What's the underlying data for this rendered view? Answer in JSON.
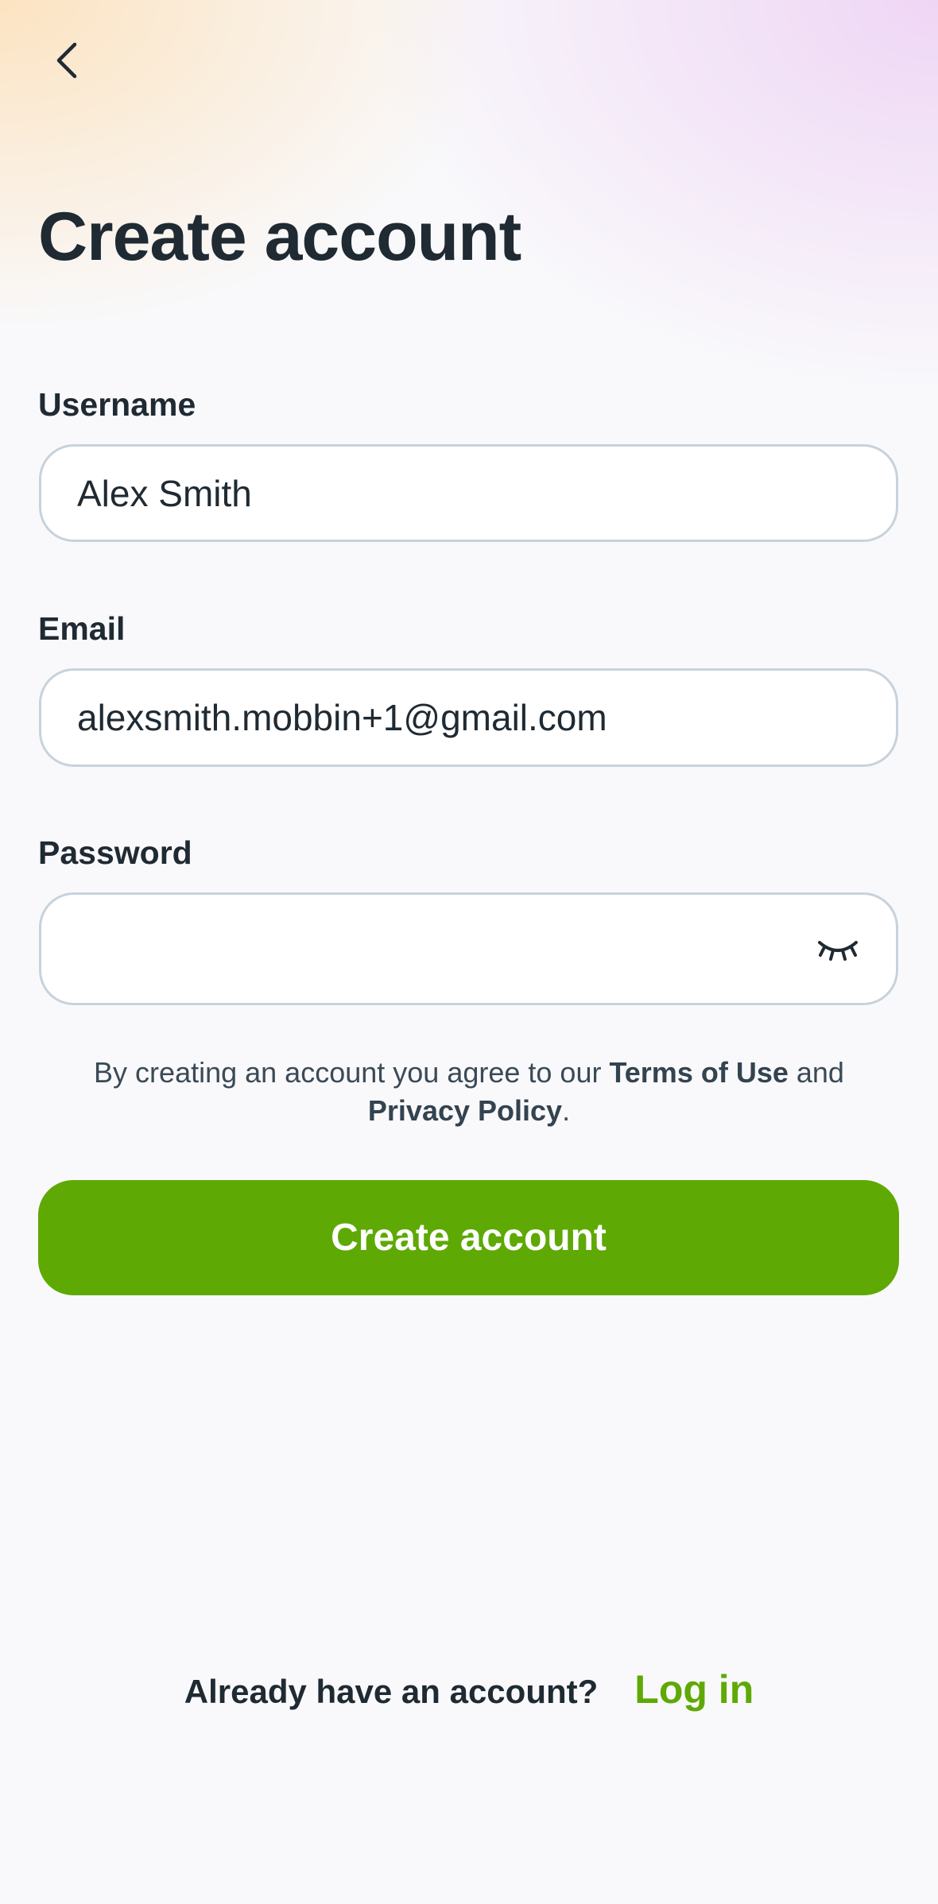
{
  "header": {
    "back_icon": "chevron-left-icon",
    "title": "Create account"
  },
  "form": {
    "username": {
      "label": "Username",
      "value": "Alex Smith"
    },
    "email": {
      "label": "Email",
      "value": "alexsmith.mobbin+1@gmail.com"
    },
    "password": {
      "label": "Password",
      "value": "",
      "toggle_icon": "eye-closed-icon"
    },
    "legal": {
      "prefix": "By creating an account you agree to our ",
      "terms_link": "Terms of Use",
      "middle": " and ",
      "privacy_link": "Privacy Policy",
      "suffix": "."
    },
    "submit_label": "Create account"
  },
  "footer": {
    "question": "Already have an account?",
    "login_label": "Log in"
  },
  "colors": {
    "accent": "#5ea904",
    "text": "#1f2a33",
    "field_border": "#c7d2dc"
  }
}
